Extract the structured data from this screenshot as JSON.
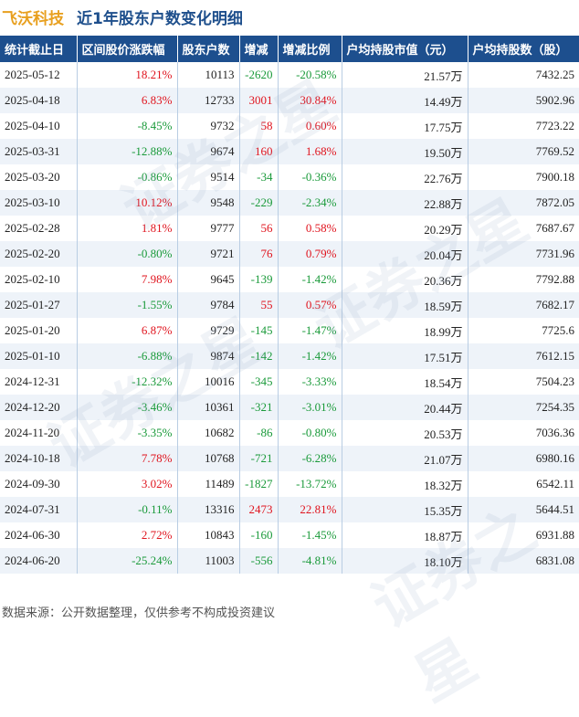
{
  "title": {
    "company": "飞沃科技",
    "subtitle": "近1年股东户数变化明细"
  },
  "table": {
    "headers": [
      "统计截止日",
      "区间股价涨跌幅",
      "股东户数",
      "增减",
      "增减比例",
      "户均持股市值（元）",
      "户均持股数（股）"
    ],
    "rows": [
      [
        "2025-05-12",
        "18.21%",
        "10113",
        "-2620",
        "-20.58%",
        "21.57万",
        "7432.25"
      ],
      [
        "2025-04-18",
        "6.83%",
        "12733",
        "3001",
        "30.84%",
        "14.49万",
        "5902.96"
      ],
      [
        "2025-04-10",
        "-8.45%",
        "9732",
        "58",
        "0.60%",
        "17.75万",
        "7723.22"
      ],
      [
        "2025-03-31",
        "-12.88%",
        "9674",
        "160",
        "1.68%",
        "19.50万",
        "7769.52"
      ],
      [
        "2025-03-20",
        "-0.86%",
        "9514",
        "-34",
        "-0.36%",
        "22.76万",
        "7900.18"
      ],
      [
        "2025-03-10",
        "10.12%",
        "9548",
        "-229",
        "-2.34%",
        "22.88万",
        "7872.05"
      ],
      [
        "2025-02-28",
        "1.81%",
        "9777",
        "56",
        "0.58%",
        "20.29万",
        "7687.67"
      ],
      [
        "2025-02-20",
        "-0.80%",
        "9721",
        "76",
        "0.79%",
        "20.04万",
        "7731.96"
      ],
      [
        "2025-02-10",
        "7.98%",
        "9645",
        "-139",
        "-1.42%",
        "20.36万",
        "7792.88"
      ],
      [
        "2025-01-27",
        "-1.55%",
        "9784",
        "55",
        "0.57%",
        "18.59万",
        "7682.17"
      ],
      [
        "2025-01-20",
        "6.87%",
        "9729",
        "-145",
        "-1.47%",
        "18.99万",
        "7725.6"
      ],
      [
        "2025-01-10",
        "-6.88%",
        "9874",
        "-142",
        "-1.42%",
        "17.51万",
        "7612.15"
      ],
      [
        "2024-12-31",
        "-12.32%",
        "10016",
        "-345",
        "-3.33%",
        "18.54万",
        "7504.23"
      ],
      [
        "2024-12-20",
        "-3.46%",
        "10361",
        "-321",
        "-3.01%",
        "20.44万",
        "7254.35"
      ],
      [
        "2024-11-20",
        "-3.35%",
        "10682",
        "-86",
        "-0.80%",
        "20.53万",
        "7036.36"
      ],
      [
        "2024-10-18",
        "7.78%",
        "10768",
        "-721",
        "-6.28%",
        "21.07万",
        "6980.16"
      ],
      [
        "2024-09-30",
        "3.02%",
        "11489",
        "-1827",
        "-13.72%",
        "18.32万",
        "6542.11"
      ],
      [
        "2024-07-31",
        "-0.11%",
        "13316",
        "2473",
        "22.81%",
        "15.35万",
        "5644.51"
      ],
      [
        "2024-06-30",
        "2.72%",
        "10843",
        "-160",
        "-1.45%",
        "18.87万",
        "6931.88"
      ],
      [
        "2024-06-20",
        "-25.24%",
        "11003",
        "-556",
        "-4.81%",
        "18.10万",
        "6831.08"
      ]
    ]
  },
  "colors": {
    "header_bg": "#1d4f8e",
    "positive": "#e0141e",
    "negative": "#1a9a3a",
    "company": "#e8a020",
    "subtitle": "#1e4f8c"
  },
  "footer": "数据来源：公开数据整理，仅供参考不构成投资建议",
  "watermark": "证券之星"
}
